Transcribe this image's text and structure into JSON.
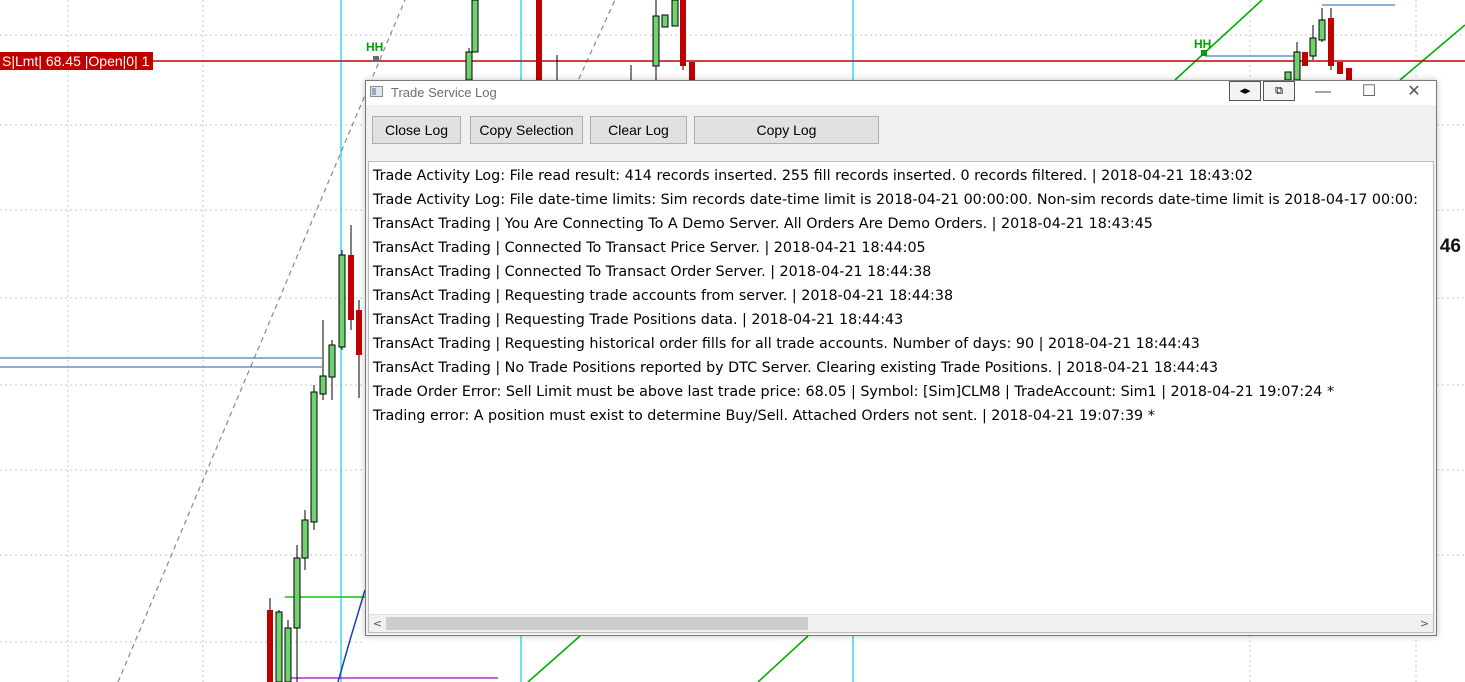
{
  "chart": {
    "order_tag": "S|Lmt| 68.45 |Open|0| 1",
    "hh_labels": [
      "HH",
      "HH"
    ],
    "price_label": "46",
    "colors": {
      "order_line": "#c00000",
      "up_candle": "#6ed36e",
      "down_candle": "#c00000",
      "trend_line": "#00b000",
      "session_line": "#33ddee",
      "grid": "#c8c8c8"
    }
  },
  "dialog": {
    "title": "Trade Service Log",
    "icon": "app-window-icon",
    "titlebar_buttons": {
      "dock": "◂▸",
      "detach": "⧉",
      "minimize": "—",
      "maximize": "☐",
      "close": "✕"
    },
    "toolbar": {
      "close_log": "Close Log",
      "copy_selection": "Copy Selection",
      "clear_log": "Clear Log",
      "copy_log": "Copy Log"
    },
    "log_entries": [
      "Trade Activity Log: File read result: 414 records inserted.  255 fill records inserted.  0 records filtered. | 2018-04-21  18:43:02",
      "Trade Activity Log: File date-time limits: Sim records date-time limit is 2018-04-21  00:00:00.  Non-sim records date-time limit is 2018-04-17  00:00:",
      "TransAct Trading | You Are Connecting To A Demo Server.  All Orders Are Demo Orders. | 2018-04-21  18:43:45",
      "TransAct Trading | Connected To Transact Price Server. | 2018-04-21  18:44:05",
      "TransAct Trading | Connected To Transact Order Server. | 2018-04-21  18:44:38",
      "TransAct Trading | Requesting trade accounts from server. | 2018-04-21  18:44:38",
      "TransAct Trading | Requesting Trade Positions data. | 2018-04-21  18:44:43",
      "TransAct Trading | Requesting historical order fills for all trade accounts. Number of days: 90 | 2018-04-21  18:44:43",
      "TransAct Trading | No Trade Positions reported by DTC Server. Clearing existing Trade Positions. | 2018-04-21  18:44:43",
      "Trade Order Error: Sell Limit must be above last trade price: 68.05 | Symbol: [Sim]CLM8 | TradeAccount: Sim1 | 2018-04-21  19:07:24 *",
      "Trading error: A position must exist to determine Buy/Sell. Attached Orders not sent. | 2018-04-21  19:07:39 *"
    ],
    "scrollbar": {
      "left_arrow": "<",
      "right_arrow": ">",
      "position_fraction": 0.0,
      "visible_fraction": 0.4
    }
  }
}
